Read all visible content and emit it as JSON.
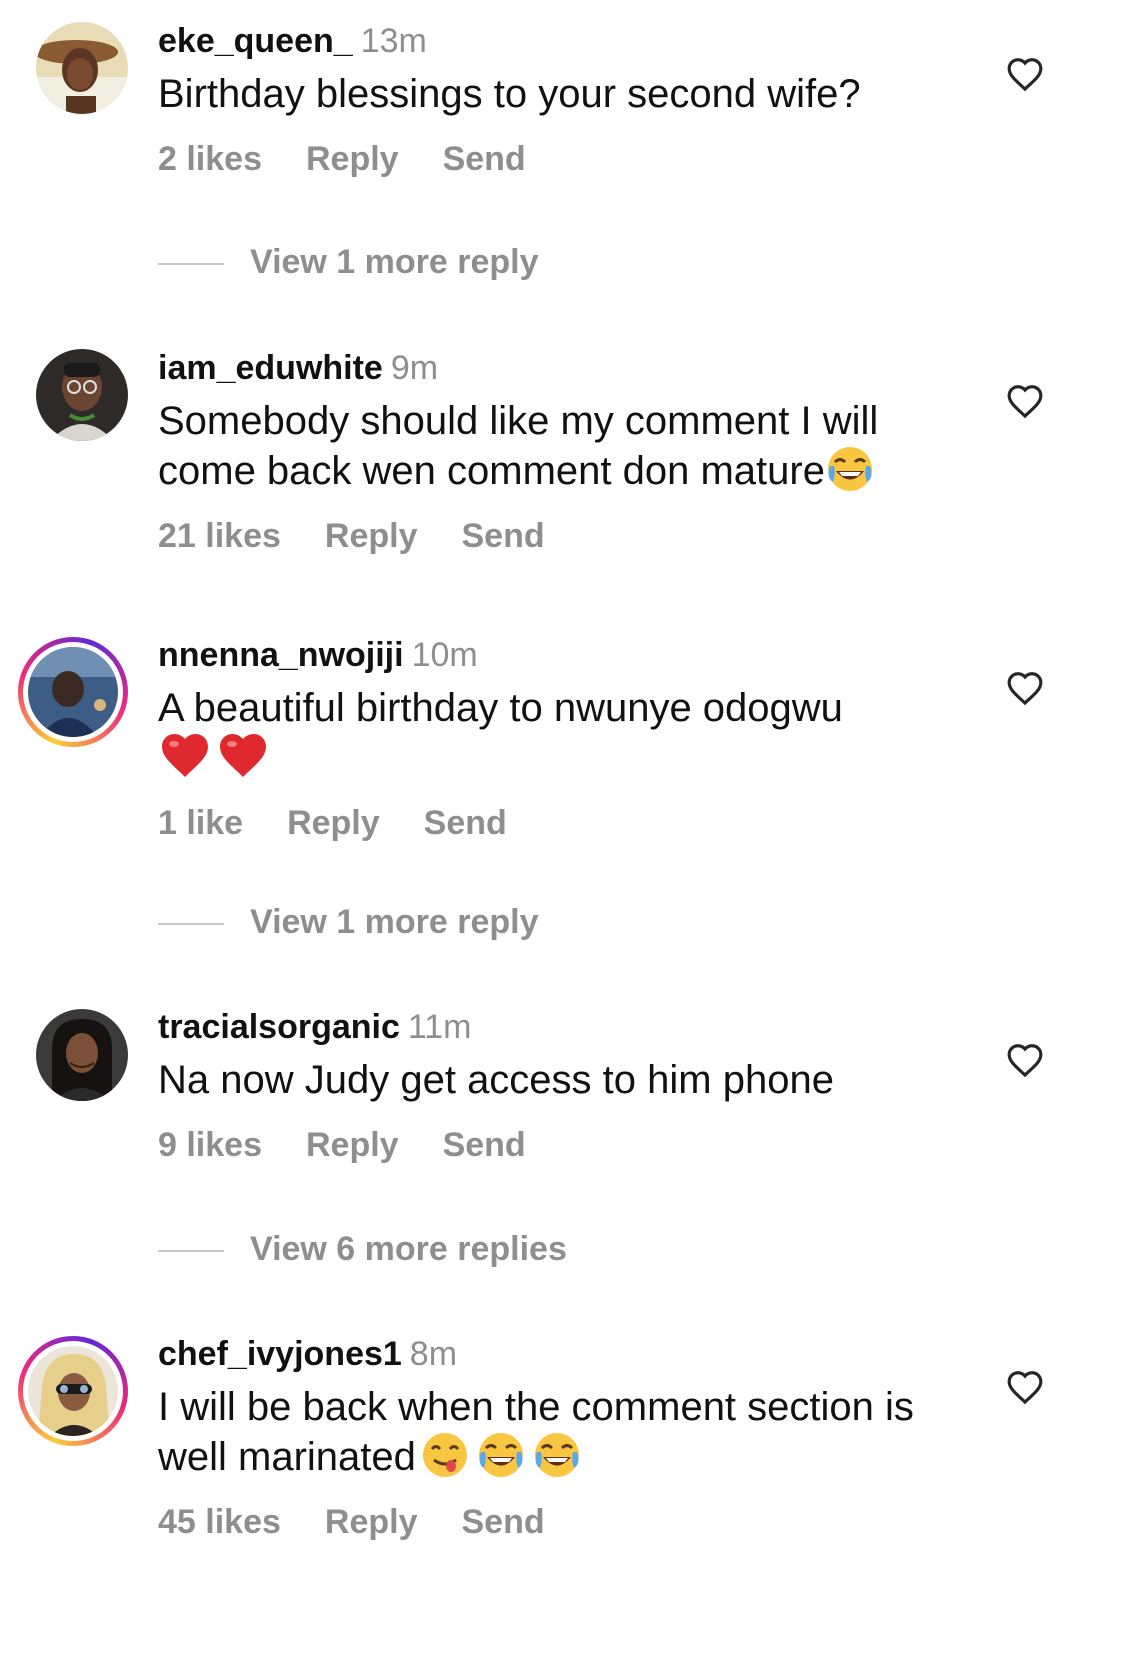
{
  "comments": [
    {
      "username": "eke_queen_",
      "time": "13m",
      "text": "Birthday blessings to your second wife?",
      "emoji": [],
      "likes": "2 likes",
      "reply": "Reply",
      "send": "Send",
      "story_ring": false,
      "more_replies": "View 1 more reply"
    },
    {
      "username": "iam_eduwhite",
      "time": "9m",
      "text": "Somebody should like my comment I will come back wen comment don mature",
      "emoji": [
        "joy"
      ],
      "likes": "21 likes",
      "reply": "Reply",
      "send": "Send",
      "story_ring": false,
      "more_replies": ""
    },
    {
      "username": "nnenna_nwojiji",
      "time": "10m",
      "text": "A beautiful birthday to nwunye odogwu",
      "emoji": [
        "red-heart",
        "red-heart"
      ],
      "likes": "1 like",
      "reply": "Reply",
      "send": "Send",
      "story_ring": true,
      "more_replies": "View 1 more reply"
    },
    {
      "username": "tracialsorganic",
      "time": "11m",
      "text": "Na now Judy get access to him phone",
      "emoji": [],
      "likes": "9 likes",
      "reply": "Reply",
      "send": "Send",
      "story_ring": false,
      "more_replies": "View 6 more replies"
    },
    {
      "username": "chef_ivyjones1",
      "time": "8m",
      "text": "I will be back when the comment section is well marinated",
      "emoji": [
        "yum",
        "joy",
        "joy"
      ],
      "likes": "45 likes",
      "reply": "Reply",
      "send": "Send",
      "story_ring": true,
      "more_replies": ""
    }
  ],
  "colors": {
    "text": "#111111",
    "secondary": "#8e8e8e",
    "divider": "#c7c7c7",
    "heart_outline": "#262626"
  }
}
